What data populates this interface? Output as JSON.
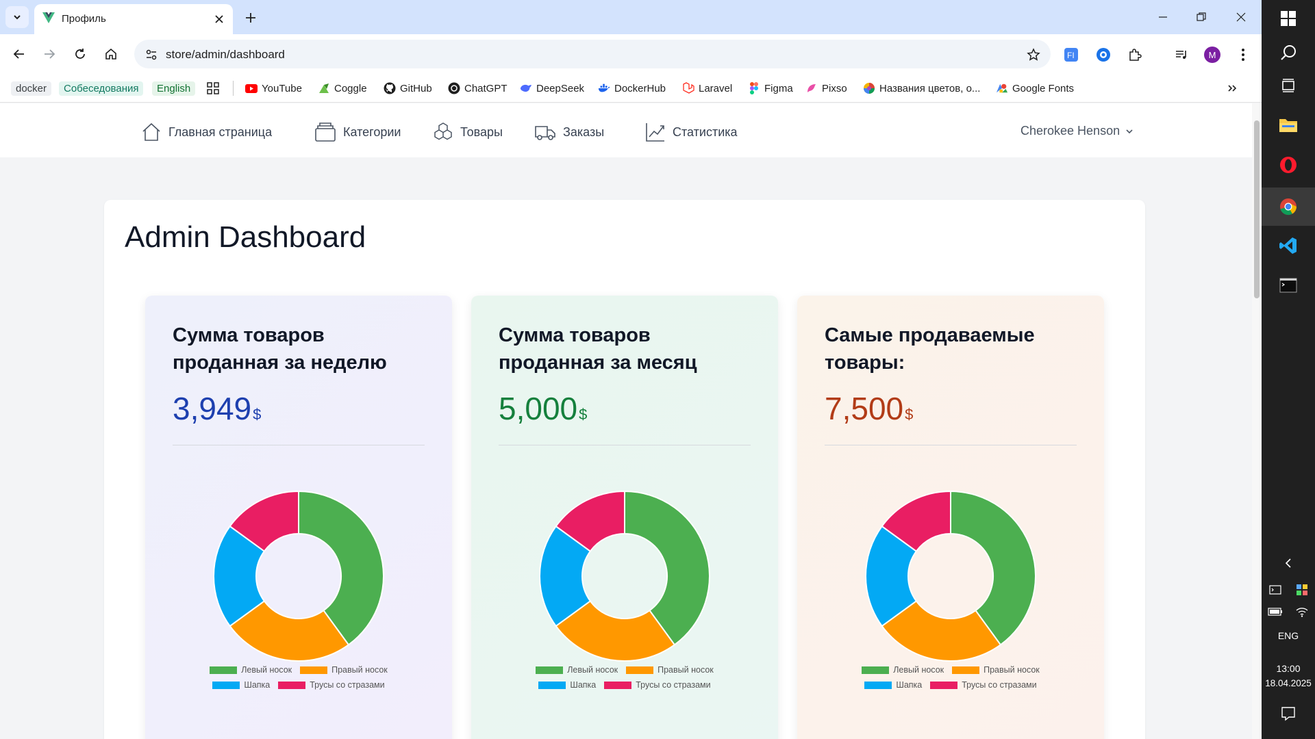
{
  "browser": {
    "tab_title": "Профиль",
    "url": "store/admin/dashboard",
    "profile_initial": "M",
    "bookmarks": {
      "docker": "docker",
      "interviews": "Собеседования",
      "english": "English",
      "youtube": "YouTube",
      "coggle": "Coggle",
      "github": "GitHub",
      "chatgpt": "ChatGPT",
      "deepseek": "DeepSeek",
      "dockerhub": "DockerHub",
      "laravel": "Laravel",
      "figma": "Figma",
      "pixso": "Pixso",
      "colors": "Названия цветов, о...",
      "googlefonts": "Google Fonts"
    }
  },
  "nav": {
    "home": "Главная страница",
    "categories": "Категории",
    "products": "Товары",
    "orders": "Заказы",
    "stats": "Статистика",
    "user": "Cherokee Henson"
  },
  "dashboard": {
    "title": "Admin Dashboard",
    "cards": [
      {
        "title": "Сумма товаров проданная за неделю",
        "amount": "3,949",
        "currency": "$",
        "color": "#1e40af"
      },
      {
        "title": "Сумма товаров проданная за месяц",
        "amount": "5,000",
        "currency": "$",
        "color": "#15803d"
      },
      {
        "title": "Самые продаваемые товары:",
        "amount": "7,500",
        "currency": "$",
        "color": "#b23c17"
      }
    ]
  },
  "chart_data": [
    {
      "type": "pie",
      "categories": [
        "Левый носок",
        "Правый носок",
        "Шапка",
        "Трусы со стразами"
      ],
      "values": [
        40,
        25,
        20,
        15
      ],
      "colors": [
        "#4caf50",
        "#ff9800",
        "#03a9f4",
        "#e91e63"
      ],
      "legend": "bottom"
    },
    {
      "type": "pie",
      "categories": [
        "Левый носок",
        "Правый носок",
        "Шапка",
        "Трусы со стразами"
      ],
      "values": [
        40,
        25,
        20,
        15
      ],
      "colors": [
        "#4caf50",
        "#ff9800",
        "#03a9f4",
        "#e91e63"
      ],
      "legend": "bottom"
    },
    {
      "type": "pie",
      "categories": [
        "Левый носок",
        "Правый носок",
        "Шапка",
        "Трусы со стразами"
      ],
      "values": [
        40,
        25,
        20,
        15
      ],
      "colors": [
        "#4caf50",
        "#ff9800",
        "#03a9f4",
        "#e91e63"
      ],
      "legend": "bottom"
    }
  ],
  "taskbar": {
    "lang": "ENG",
    "time": "13:00",
    "date": "18.04.2025"
  }
}
